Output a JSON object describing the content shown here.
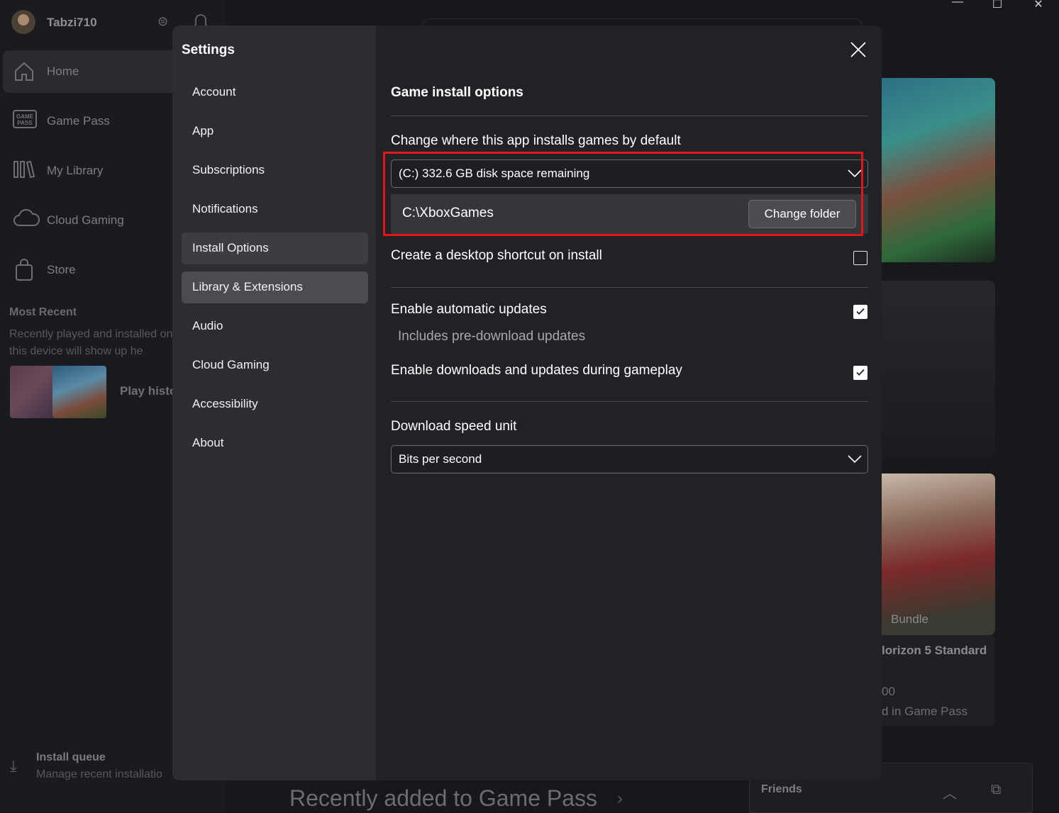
{
  "background": {
    "profile": {
      "name": "Tabzi710"
    },
    "nav": [
      {
        "label": "Home",
        "icon": "home-icon",
        "active": true
      },
      {
        "label": "Game Pass",
        "icon": "game-pass-icon"
      },
      {
        "label": "My Library",
        "icon": "library-icon"
      },
      {
        "label": "Cloud Gaming",
        "icon": "cloud-icon"
      },
      {
        "label": "Store",
        "icon": "store-icon"
      }
    ],
    "most_recent": {
      "title": "Most Recent",
      "text": "Recently played and installed on this device will show up he"
    },
    "play_history": "Play histo",
    "install_queue": {
      "title": "Install queue",
      "subtitle": "Manage recent installatio"
    },
    "card": {
      "bundle": "Bundle",
      "title": "lorizon 5 Standard",
      "price": "00",
      "gamepass": "d in Game Pass"
    },
    "recently_added": "Recently added to Game Pass",
    "friends": "Friends"
  },
  "settings": {
    "title": "Settings",
    "nav": [
      {
        "label": "Account"
      },
      {
        "label": "App"
      },
      {
        "label": "Subscriptions"
      },
      {
        "label": "Notifications"
      },
      {
        "label": "Install Options",
        "selected": true
      },
      {
        "label": "Library & Extensions",
        "hover": true
      },
      {
        "label": "Audio"
      },
      {
        "label": "Cloud Gaming"
      },
      {
        "label": "Accessibility"
      },
      {
        "label": "About"
      }
    ],
    "content": {
      "heading": "Game install options",
      "install_location": {
        "label": "Change where this app installs games by default",
        "drive_value": "(C:) 332.6 GB disk space remaining",
        "folder_path": "C:\\XboxGames",
        "change_folder_label": "Change folder"
      },
      "desktop_shortcut": {
        "label": "Create a desktop shortcut on install",
        "checked": false
      },
      "auto_updates": {
        "label": "Enable automatic updates",
        "sub": "Includes pre-download updates",
        "checked": true
      },
      "gameplay_downloads": {
        "label": "Enable downloads and updates during gameplay",
        "checked": true
      },
      "speed_unit": {
        "label": "Download speed unit",
        "value": "Bits per second"
      }
    }
  },
  "colors": {
    "highlight": "#e3141c",
    "dialog_bg": "#202225",
    "nav_bg": "#2b2d31"
  }
}
